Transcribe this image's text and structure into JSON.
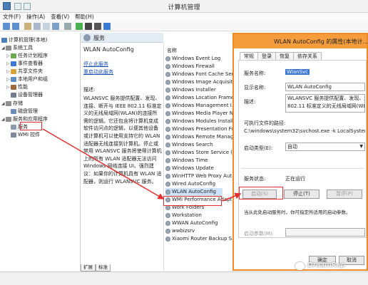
{
  "window": {
    "title": "计算机管理"
  },
  "menu": [
    "文件(F)",
    "操作(A)",
    "查看(V)",
    "帮助(H)"
  ],
  "tree": [
    {
      "label": "计算机管理(本地)",
      "level": 0,
      "toggle": "",
      "color": "#4a7fb8"
    },
    {
      "label": "系统工具",
      "level": 1,
      "toggle": "◢",
      "color": "#8f8f8f"
    },
    {
      "label": "任务计划程序",
      "level": 2,
      "toggle": "▷",
      "color": "#6aa84f"
    },
    {
      "label": "事件查看器",
      "level": 2,
      "toggle": "▷",
      "color": "#3c78d8"
    },
    {
      "label": "共享文件夹",
      "level": 2,
      "toggle": "▷",
      "color": "#d9a33a"
    },
    {
      "label": "本地用户和组",
      "level": 2,
      "toggle": "▷",
      "color": "#5f8dc6"
    },
    {
      "label": "性能",
      "level": 2,
      "toggle": "▷",
      "color": "#9c6a3d"
    },
    {
      "label": "设备管理器",
      "level": 2,
      "toggle": "",
      "color": "#6f7f8f"
    },
    {
      "label": "存储",
      "level": 1,
      "toggle": "◢",
      "color": "#8f8f8f"
    },
    {
      "label": "磁盘管理",
      "level": 2,
      "toggle": "",
      "color": "#6c8ebf"
    },
    {
      "label": "服务和应用程序",
      "level": 1,
      "toggle": "◢",
      "color": "#8f8f8f"
    },
    {
      "label": "服务",
      "level": 2,
      "toggle": "",
      "color": "#8a9bb0"
    },
    {
      "label": "WMI 控件",
      "level": 2,
      "toggle": "",
      "color": "#7a8a9a"
    }
  ],
  "middle": {
    "header": "服务",
    "service_name": "WLAN AutoConfig",
    "stop_link": "停止此服务",
    "restart_link": "重启动此服务",
    "desc_label": "描述:",
    "desc_text": "WLANSVC 服务提供配置、发现、连接、断开与 IEEE 802.11 标准定义的无线局域网(WLAN)的连接所需的逻辑。它还包含将计算机变成软件访问点的逻辑，以便其他设备或计算机可以使用支持它的 WLAN 适配器无线连接到计算机。停止或禁用 WLANSVC 服务将使得计算机上的所有 WLAN 适配器无法访问 Windows 网络连接 UI。强烈建议：如果你的计算机具有 WLAN 适配器，则运行 WLANSVC 服务。"
  },
  "list": {
    "header": "名称",
    "items": [
      "Windows Event Log",
      "Windows Firewall",
      "Windows Font Cache Ser...",
      "Windows Image Acquisiti...",
      "Windows Installer",
      "Windows Location Frame...",
      "Windows Management I...",
      "Windows Media Player N...",
      "Windows Modules Install...",
      "Windows Presentation Fo...",
      "Windows Remote Manag...",
      "Windows Search",
      "Windows Store Service (...",
      "Windows Time",
      "Windows Update",
      "WinHTTP Web Proxy Aut...",
      "Wired AutoConfig",
      "WLAN AutoConfig",
      "WMI Performance Adapt...",
      "Work Folders",
      "Workstation",
      "WWAN AutoConfig",
      "wwbizsrv",
      "Xiaomi Router Backup S..."
    ],
    "selected_index": 17
  },
  "bottom_tabs": [
    "扩展",
    "标准"
  ],
  "dialog": {
    "title": "WLAN AutoConfig 的属性(本地计...",
    "tabs": [
      "常规",
      "登录",
      "恢复",
      "依存关系"
    ],
    "service_name_label": "服务名称:",
    "service_name_value": "WlanSvc",
    "display_name_label": "显示名称:",
    "display_name_value": "WLAN AutoConfig",
    "desc_label": "描述:",
    "desc_value_line1": "WLANSVC 服务提供配置、发现、连接",
    "desc_value_line2": "802.11 标准定义的无线局域网(WLAN)",
    "path_label": "可执行文件的路径:",
    "path_value": "C:\\windows\\system32\\svchost.exe -k LocalSystemNetw",
    "startup_label": "启动类型(E):",
    "startup_value": "自动",
    "status_label": "服务状态:",
    "status_value": "正在运行",
    "btn_start": "启动(S)",
    "btn_stop": "停止(T)",
    "btn_pause": "暂停(P)",
    "hint": "当从此处启动服务时，你可指定所适用的启动参数。",
    "params_label": "启动参数(M):",
    "btn_ok": "确定",
    "btn_cancel": "取消"
  },
  "watermark": "DreamRep",
  "colors": {
    "accent": "#f08a24",
    "annotation": "#e23030",
    "selection": "#cde3f7"
  }
}
